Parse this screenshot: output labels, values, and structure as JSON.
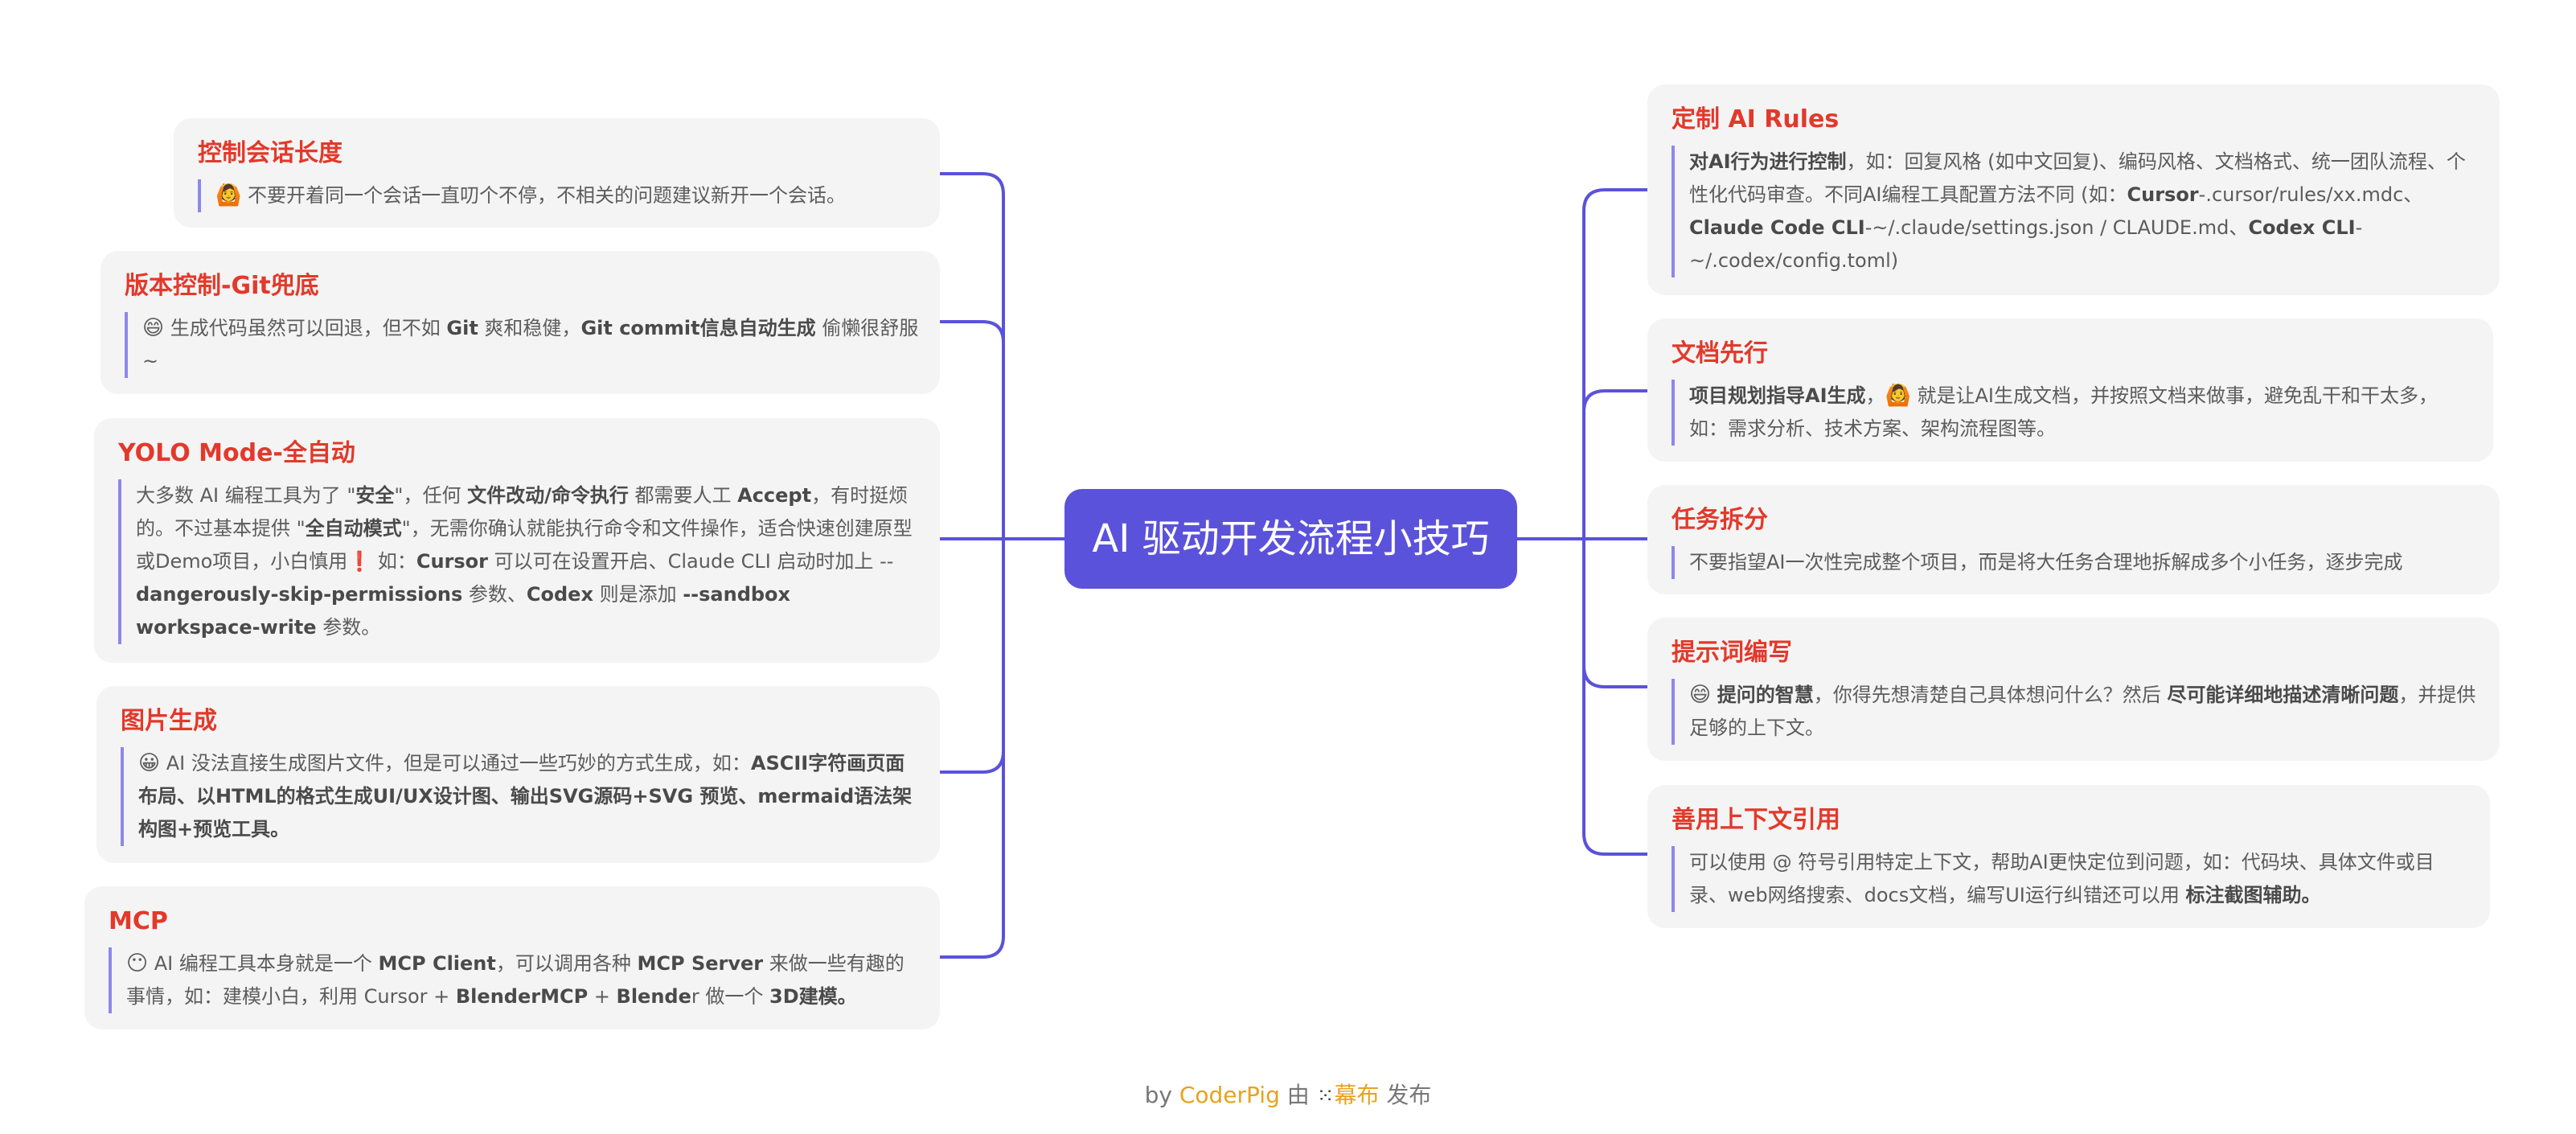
{
  "center": {
    "title": "AI 驱动开发流程小技巧"
  },
  "left": [
    {
      "title": "控制会话长度",
      "emoji": "🙆",
      "text": "不要开着同一个会话一直叨个不停，不相关的问题建议新开一个会话。"
    },
    {
      "title": "版本控制-Git兜底",
      "emoji": "😄",
      "p1": "生成代码虽然可以回退，但不如 ",
      "b1": "Git",
      "p2": " 爽和稳健，",
      "b2": "Git commit信息自动生成",
      "p3": " 偷懒很舒服~"
    },
    {
      "title": "YOLO Mode-全自动",
      "p1": "大多数 AI 编程工具为了 \"",
      "b1": "安全",
      "p2": "\"，任何 ",
      "b2": "文件改动/命令执行",
      "p3": " 都需要人工 ",
      "b3": "Accept",
      "p4": "，有时挺烦的。不过基本提供 \"",
      "b4": "全自动模式",
      "p5": "\"，无需你确认就能执行命令和文件操作，适合快速创建原型或Demo项目，小白慎用",
      "warn": "❗",
      "p6": " 如：",
      "b5": "Cursor",
      "p7": " 可以可在设置开启、Claude CLI 启动时加上 --",
      "b6": "dangerously-skip-permissions",
      "p8": " 参数、",
      "b7": "Codex",
      "p9": " 则是添加 ",
      "b8": "--sandbox workspace-write",
      "p10": " 参数。"
    },
    {
      "title": "图片生成",
      "emoji": "😀",
      "p1": "AI 没法直接生成图片文件，但是可以通过一些巧妙的方式生成，如：",
      "b1": "ASCII字符画页面布局、以HTML的格式生成UI/UX设计图、输出SVG源码+SVG 预览、mermaid语法架构图+预览工具。"
    },
    {
      "title": "MCP",
      "emoji": "😶",
      "p1": "AI 编程工具本身就是一个 ",
      "b1": "MCP Client",
      "p2": "，可以调用各种 ",
      "b2": "MCP Server",
      "p3": " 来做一些有趣的事情，如：建模小白，利用 Cursor + ",
      "b3": "BlenderMCP",
      "p4": " + ",
      "b4": "Blende",
      "p5": "r 做一个 ",
      "b5": "3D建模。"
    }
  ],
  "right": [
    {
      "title": "定制 AI Rules",
      "b1": "对AI行为进行控制",
      "p1": "，如：回复风格 (如中文回复)、编码风格、文档格式、统一团队流程、个性化代码审查。不同AI编程工具配置方法不同 (如：",
      "b2": "Cursor",
      "p2": "-.cursor/rules/xx.mdc、",
      "b3": "Claude Code CLI",
      "p3": "-~/.claude/settings.json / CLAUDE.md、",
      "b4": "Codex CLI",
      "p4": "-~/.codex/config.toml)"
    },
    {
      "title": "文档先行",
      "b1": "项目规划指导AI生成",
      "p1": "，",
      "emoji": "🙆",
      "p2": " 就是让AI生成文档，并按照文档来做事，避免乱干和干太多，如：需求分析、技术方案、架构流程图等。"
    },
    {
      "title": "任务拆分",
      "text": "不要指望AI一次性完成整个项目，而是将大任务合理地拆解成多个小任务，逐步完成"
    },
    {
      "title": "提示词编写",
      "emoji": "😄",
      "b1": "提问的智慧",
      "p1": "，你得先想清楚自己具体想问什么？然后 ",
      "b2": "尽可能详细地描述清晰问题",
      "p2": "，并提供足够的上下文。"
    },
    {
      "title": "善用上下文引用",
      "p1": "可以使用 @ 符号引用特定上下文，帮助AI更快定位到问题，如：代码块、具体文件或目录、web网络搜索、docs文档，编写UI运行纠错还可以用 ",
      "b1": "标注截图辅助。"
    }
  ],
  "footer": {
    "by": "by ",
    "author": "CoderPig",
    "mid": " 由 ",
    "logo_icon": "⁙",
    "platform": "幕布",
    "tail": " 发布"
  },
  "colors": {
    "center_bg": "#5b52db",
    "title_red": "#e2392b",
    "line": "#5b52db",
    "node_bg": "#f4f4f4",
    "brand": "#e8a21f"
  }
}
